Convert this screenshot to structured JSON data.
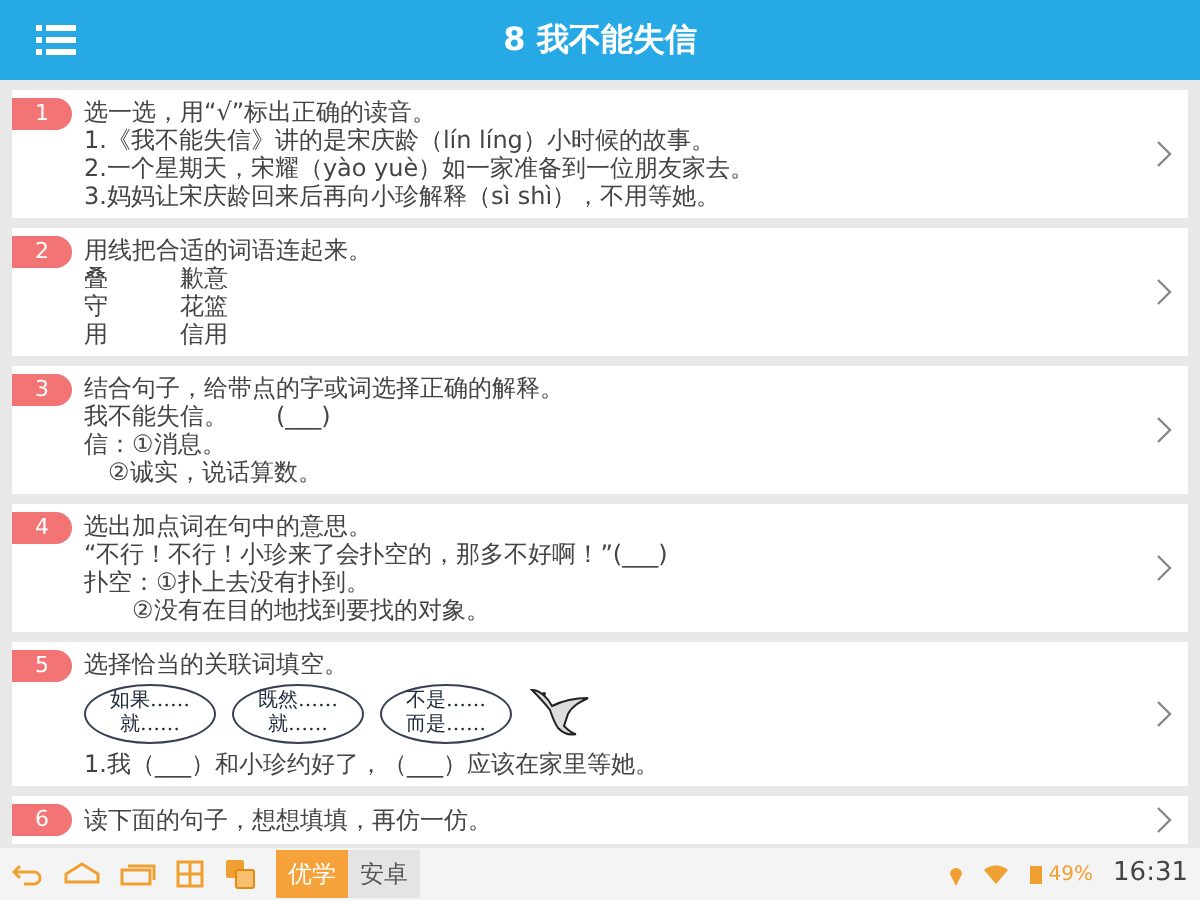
{
  "header": {
    "title": "8 我不能失信"
  },
  "items": [
    {
      "number": "1",
      "kind": "text",
      "title": "选一选，用“√”标出正确的读音。",
      "lines": [
        "1.《我不能失信》讲的是宋庆龄（lín líng）小时候的故事。",
        "2.一个星期天，宋耀（yào yuè）如一家准备到一位朋友家去。",
        "3.妈妈让宋庆龄回来后再向小珍解释（sì shì），不用等她。"
      ]
    },
    {
      "number": "2",
      "kind": "matching",
      "title": "用线把合适的词语连起来。",
      "pairs": [
        [
          "叠",
          "歉意"
        ],
        [
          "守",
          "花篮"
        ],
        [
          "用",
          "信用"
        ]
      ]
    },
    {
      "number": "3",
      "kind": "text",
      "title": "结合句子，给带点的字或词选择正确的解释。",
      "lines": [
        "我不能失信。　　(___)",
        "信：①消息。",
        "　②诚实，说话算数。"
      ]
    },
    {
      "number": "4",
      "kind": "text",
      "title": "选出加点词在句中的意思。",
      "lines": [
        "“不行！不行！小珍来了会扑空的，那多不好啊！”(___)",
        "扑空：①扑上去没有扑到。",
        "　　②没有在目的地找到要找的对象。"
      ]
    },
    {
      "number": "5",
      "kind": "ovals",
      "title": "选择恰当的关联词填空。",
      "ovals": [
        [
          "如果……",
          "就……"
        ],
        [
          "既然……",
          "就……"
        ],
        [
          "不是……",
          "而是……"
        ]
      ],
      "lines": [
        "1.我（___）和小珍约好了，（___）应该在家里等她。"
      ]
    },
    {
      "number": "6",
      "kind": "text",
      "title": "读下面的句子，想想填填，再仿一仿。"
    }
  ],
  "taskbar": {
    "tabs": [
      {
        "label": "优学",
        "selected": true
      },
      {
        "label": "安卓",
        "selected": false
      }
    ],
    "battery": "49%",
    "time": "16:31"
  }
}
